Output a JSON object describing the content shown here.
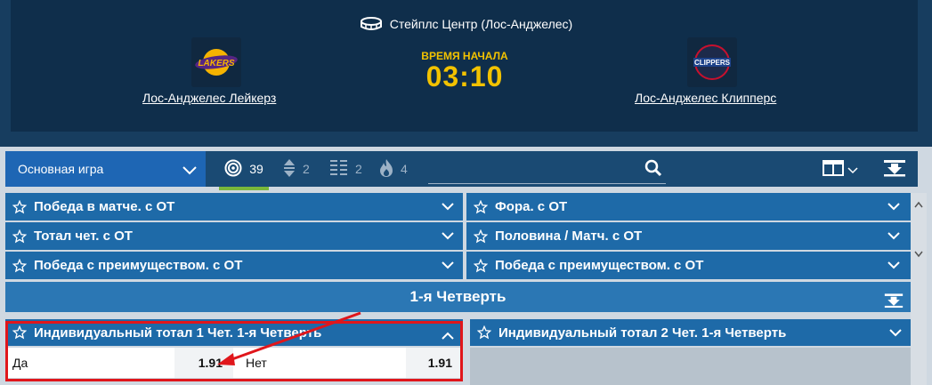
{
  "header": {
    "venue": "Стейплс Центр (Лос-Анджелес)",
    "home_team": "Лос-Анджелес Лейкерз",
    "away_team": "Лос-Анджелес Клипперс",
    "start_label": "ВРЕМЯ НАЧАЛА",
    "start_time": "03:10",
    "home_logo_text": "LAKERS",
    "away_logo_text": "CLIPPERS",
    "icons": {
      "venue": "stadium-icon"
    }
  },
  "toolbar": {
    "select_value": "Основная игра",
    "tabs": [
      {
        "icon": "target-icon",
        "count": "39"
      },
      {
        "icon": "sort-arrows-icon",
        "count": "2"
      },
      {
        "icon": "list-bars-icon",
        "count": "2"
      },
      {
        "icon": "fire-icon",
        "count": "4"
      }
    ],
    "search_value": ""
  },
  "markets": {
    "left": [
      "Победа в матче. с ОТ",
      "Тотал чет. с ОТ",
      "Победа с преимуществом. с ОТ"
    ],
    "right": [
      "Фора. с ОТ",
      "Половина / Матч. с ОТ",
      "Победа с преимуществом. с ОТ"
    ]
  },
  "section": {
    "title": "1-я Четверть",
    "sub_left": "Индивидуальный тотал 1 Чет. 1-я Четверть",
    "sub_right": "Индивидуальный тотал 2 Чет. 1-я Четверть",
    "odds": [
      {
        "label": "Да",
        "value": "1.91"
      },
      {
        "label": "Нет",
        "value": "1.91"
      }
    ]
  },
  "colors": {
    "header_bg": "#0f2e4b",
    "accent_yellow": "#f2c200",
    "market_blue": "#1e6aa8",
    "select_blue": "#1e66b4",
    "active_green": "#7ab83b",
    "highlight_red": "#e0161b"
  }
}
